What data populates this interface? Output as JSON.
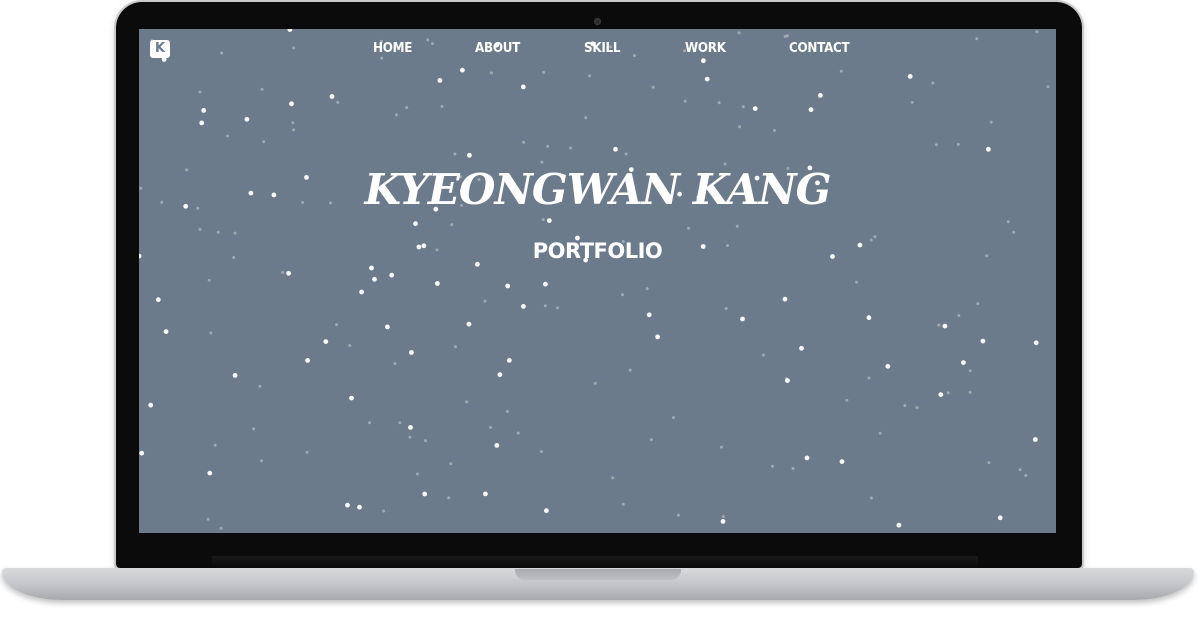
{
  "page": {
    "screen_background": "#6c7b8b",
    "text_color": "#ffffff"
  },
  "header": {
    "logo_letter": "K",
    "nav": [
      {
        "label": "HOME"
      },
      {
        "label": "ABOUT"
      },
      {
        "label": "SKILL"
      },
      {
        "label": "WORK"
      },
      {
        "label": "CONTACT"
      }
    ]
  },
  "hero": {
    "title": "KYEONGWAN KANG",
    "subtitle": "PORTFOLIO"
  }
}
